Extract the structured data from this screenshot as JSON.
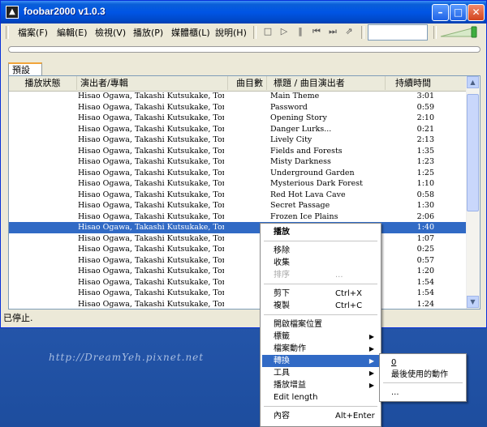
{
  "window": {
    "title": "foobar2000 v1.0.3",
    "icon": "foobar-icon"
  },
  "menubar": [
    {
      "label": "檔案(F)",
      "u": "F"
    },
    {
      "label": "編輯(E)",
      "u": "E"
    },
    {
      "label": "檢視(V)",
      "u": "V"
    },
    {
      "label": "播放(P)",
      "u": "P"
    },
    {
      "label": "媒體櫃(L)",
      "u": "L"
    },
    {
      "label": "說明(H)",
      "u": "H"
    }
  ],
  "tab": {
    "label": "預設"
  },
  "columns": {
    "status": "播放狀態",
    "artist": "演出者/專輯",
    "track": "曲目數",
    "title": "標題 / 曲目演出者",
    "length": "持續時間"
  },
  "rows": [
    {
      "artist": "Hisao Ogawa, Takashi Kutsukake, Tomok...",
      "title": "Main Theme",
      "length": "3:01"
    },
    {
      "artist": "Hisao Ogawa, Takashi Kutsukake, Tomok...",
      "title": "Password",
      "length": "0:59"
    },
    {
      "artist": "Hisao Ogawa, Takashi Kutsukake, Tomok...",
      "title": "Opening Story",
      "length": "2:10"
    },
    {
      "artist": "Hisao Ogawa, Takashi Kutsukake, Tomok...",
      "title": "Danger Lurks...",
      "length": "0:21"
    },
    {
      "artist": "Hisao Ogawa, Takashi Kutsukake, Tomok...",
      "title": "Lively City",
      "length": "2:13"
    },
    {
      "artist": "Hisao Ogawa, Takashi Kutsukake, Tomok...",
      "title": "Fields and Forests",
      "length": "1:35"
    },
    {
      "artist": "Hisao Ogawa, Takashi Kutsukake, Tomok...",
      "title": "Misty Darkness",
      "length": "1:23"
    },
    {
      "artist": "Hisao Ogawa, Takashi Kutsukake, Tomok...",
      "title": "Underground Garden",
      "length": "1:25"
    },
    {
      "artist": "Hisao Ogawa, Takashi Kutsukake, Tomok...",
      "title": "Mysterious Dark Forest",
      "length": "1:10"
    },
    {
      "artist": "Hisao Ogawa, Takashi Kutsukake, Tomok...",
      "title": "Red Hot Lava Cave",
      "length": "0:58"
    },
    {
      "artist": "Hisao Ogawa, Takashi Kutsukake, Tomok...",
      "title": "Secret Passage",
      "length": "1:30"
    },
    {
      "artist": "Hisao Ogawa, Takashi Kutsukake, Tomok...",
      "title": "Frozen Ice Plains",
      "length": "2:06"
    },
    {
      "artist": "Hisao Ogawa, Takashi Kutsukake, Tomok...",
      "title": "",
      "length": "1:40",
      "selected": true
    },
    {
      "artist": "Hisao Ogawa, Takashi Kutsukake, Tomok...",
      "title": "",
      "length": "1:07"
    },
    {
      "artist": "Hisao Ogawa, Takashi Kutsukake, Tomok...",
      "title": "",
      "length": "0:25"
    },
    {
      "artist": "Hisao Ogawa, Takashi Kutsukake, Tomok...",
      "title": "",
      "length": "0:57"
    },
    {
      "artist": "Hisao Ogawa, Takashi Kutsukake, Tomok...",
      "title": "",
      "length": "1:20"
    },
    {
      "artist": "Hisao Ogawa, Takashi Kutsukake, Tomok...",
      "title": "",
      "length": "1:54"
    },
    {
      "artist": "Hisao Ogawa, Takashi Kutsukake, Tomok...",
      "title": "",
      "length": "1:54"
    },
    {
      "artist": "Hisao Ogawa, Takashi Kutsukake, Tomok...",
      "title": "",
      "length": "1:24"
    }
  ],
  "status_bar": "已停止.",
  "context_menu": {
    "play": "播放",
    "remove": "移除",
    "crop": "收集",
    "sort": "排序",
    "sort_shortcut": "...",
    "cut": "剪下",
    "cut_shortcut": "Ctrl+X",
    "copy": "複製",
    "copy_shortcut": "Ctrl+C",
    "open_folder": "開啟檔案位置",
    "tagging": "標籤",
    "file_ops": "檔案動作",
    "convert": "轉換",
    "utilities": "工具",
    "replaygain": "播放增益",
    "edit_length": "Edit length",
    "properties": "內容",
    "properties_shortcut": "Alt+Enter"
  },
  "submenu": {
    "item0": "0",
    "recent": "最後使用的動作",
    "more": "..."
  },
  "watermark": "http://DreamYeh.pixnet.net"
}
